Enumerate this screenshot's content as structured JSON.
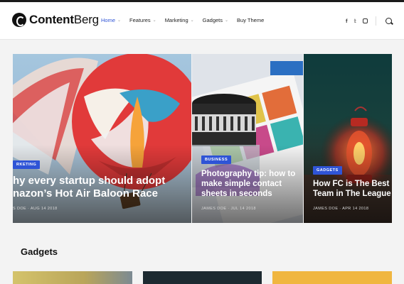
{
  "brand": {
    "name_bold": "Content",
    "name_light": "Berg"
  },
  "nav": [
    {
      "label": "Home",
      "active": true,
      "has_dropdown": true
    },
    {
      "label": "Features",
      "active": false,
      "has_dropdown": true
    },
    {
      "label": "Marketing",
      "active": false,
      "has_dropdown": true
    },
    {
      "label": "Gadgets",
      "active": false,
      "has_dropdown": true
    },
    {
      "label": "Buy Theme",
      "active": false,
      "has_dropdown": false
    }
  ],
  "social": [
    "facebook-icon",
    "twitter-icon",
    "instagram-icon"
  ],
  "featured": [
    {
      "badge": "RKETING",
      "title_line1": "hy every startup should adopt",
      "title_line2": "nazon’s Hot Air Baloon Race",
      "meta": "S DOE · AUG 14 2018"
    },
    {
      "badge": "BUSINESS",
      "title_line1": "Photography tip: how to",
      "title_line2": "make simple contact",
      "title_line3": "sheets in seconds",
      "meta": "JAMES DOE · JUL 14 2018"
    },
    {
      "badge": "GADGETS",
      "title_line1": "How FC is The Best",
      "title_line2": "Team in The League",
      "meta": "JAMES DOE · APR 14 2018"
    }
  ],
  "section": {
    "title": "Gadgets"
  },
  "colors": {
    "accent": "#2f54d6",
    "dark": "#111111"
  }
}
